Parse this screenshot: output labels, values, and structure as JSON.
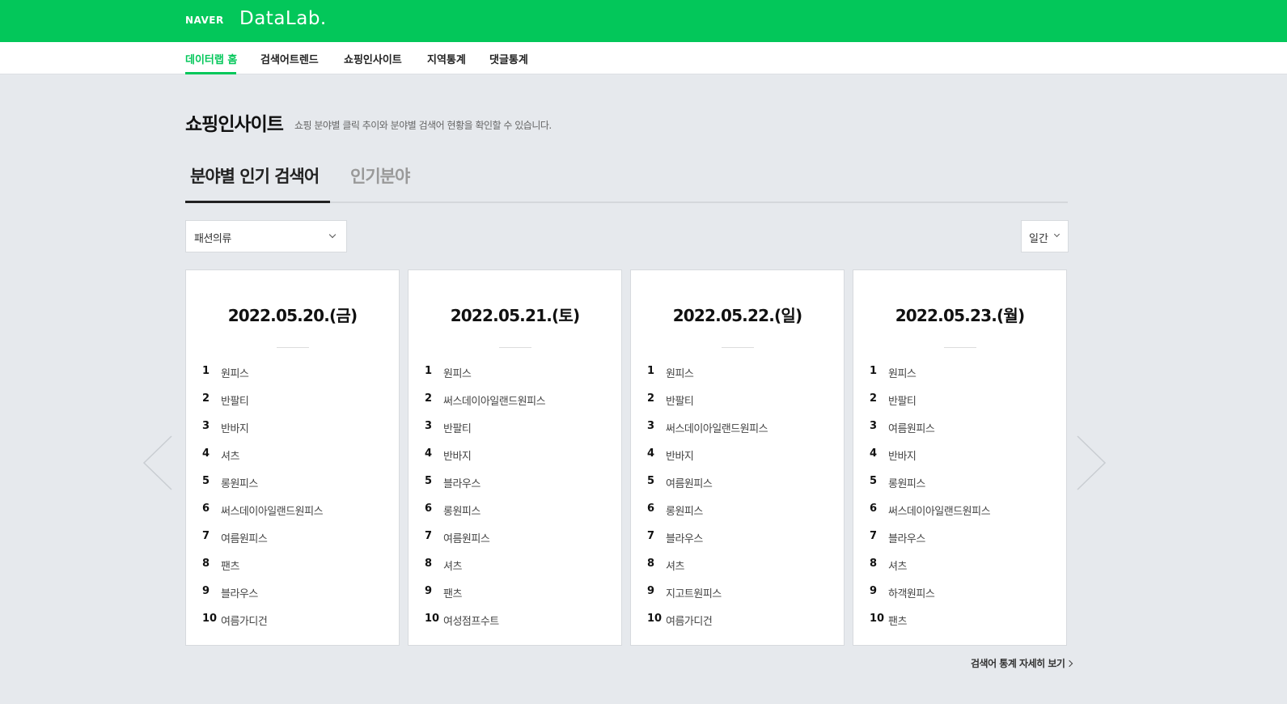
{
  "header": {
    "logo_naver": "NAVER",
    "logo_datalab": "DataLab."
  },
  "nav": {
    "items": [
      {
        "label": "데이터랩 홈"
      },
      {
        "label": "검색어트렌드"
      },
      {
        "label": "쇼핑인사이트"
      },
      {
        "label": "지역통계"
      },
      {
        "label": "댓글통계"
      }
    ],
    "active": "데이터랩 홈"
  },
  "page": {
    "title": "쇼핑인사이트",
    "description": "쇼핑 분야별 클릭 추이와 분야별 검색어 현황을 확인할 수 있습니다."
  },
  "tabs": [
    {
      "label": "분야별 인기 검색어",
      "active": true
    },
    {
      "label": "인기분야",
      "active": false
    }
  ],
  "category_select": {
    "value": "패션의류"
  },
  "period_select": {
    "value": "일간"
  },
  "cards": [
    {
      "date": "2022.05.20.(금)",
      "ranks": [
        {
          "rank": "1",
          "keyword": "원피스"
        },
        {
          "rank": "2",
          "keyword": "반팔티"
        },
        {
          "rank": "3",
          "keyword": "반바지"
        },
        {
          "rank": "4",
          "keyword": "셔츠"
        },
        {
          "rank": "5",
          "keyword": "롱원피스"
        },
        {
          "rank": "6",
          "keyword": "써스데이아일랜드원피스"
        },
        {
          "rank": "7",
          "keyword": "여름원피스"
        },
        {
          "rank": "8",
          "keyword": "팬츠"
        },
        {
          "rank": "9",
          "keyword": "블라우스"
        },
        {
          "rank": "10",
          "keyword": "여름가디건"
        }
      ]
    },
    {
      "date": "2022.05.21.(토)",
      "ranks": [
        {
          "rank": "1",
          "keyword": "원피스"
        },
        {
          "rank": "2",
          "keyword": "써스데이아일랜드원피스"
        },
        {
          "rank": "3",
          "keyword": "반팔티"
        },
        {
          "rank": "4",
          "keyword": "반바지"
        },
        {
          "rank": "5",
          "keyword": "블라우스"
        },
        {
          "rank": "6",
          "keyword": "롱원피스"
        },
        {
          "rank": "7",
          "keyword": "여름원피스"
        },
        {
          "rank": "8",
          "keyword": "셔츠"
        },
        {
          "rank": "9",
          "keyword": "팬츠"
        },
        {
          "rank": "10",
          "keyword": "여성점프수트"
        }
      ]
    },
    {
      "date": "2022.05.22.(일)",
      "ranks": [
        {
          "rank": "1",
          "keyword": "원피스"
        },
        {
          "rank": "2",
          "keyword": "반팔티"
        },
        {
          "rank": "3",
          "keyword": "써스데이아일랜드원피스"
        },
        {
          "rank": "4",
          "keyword": "반바지"
        },
        {
          "rank": "5",
          "keyword": "여름원피스"
        },
        {
          "rank": "6",
          "keyword": "롱원피스"
        },
        {
          "rank": "7",
          "keyword": "블라우스"
        },
        {
          "rank": "8",
          "keyword": "셔츠"
        },
        {
          "rank": "9",
          "keyword": "지고트원피스"
        },
        {
          "rank": "10",
          "keyword": "여름가디건"
        }
      ]
    },
    {
      "date": "2022.05.23.(월)",
      "ranks": [
        {
          "rank": "1",
          "keyword": "원피스"
        },
        {
          "rank": "2",
          "keyword": "반팔티"
        },
        {
          "rank": "3",
          "keyword": "여름원피스"
        },
        {
          "rank": "4",
          "keyword": "반바지"
        },
        {
          "rank": "5",
          "keyword": "롱원피스"
        },
        {
          "rank": "6",
          "keyword": "써스데이아일랜드원피스"
        },
        {
          "rank": "7",
          "keyword": "블라우스"
        },
        {
          "rank": "8",
          "keyword": "셔츠"
        },
        {
          "rank": "9",
          "keyword": "하객원피스"
        },
        {
          "rank": "10",
          "keyword": "팬츠"
        }
      ]
    }
  ],
  "more_link": {
    "label": "검색어 통계 자세히 보기"
  },
  "colors": {
    "brand_green": "#03c75a",
    "background": "#e6e9ed",
    "card_bg": "#ffffff"
  },
  "icons": {
    "prev": "chevron-left-icon",
    "next": "chevron-right-icon",
    "dropdown": "chevron-down-icon",
    "link": "chevron-right-icon"
  }
}
